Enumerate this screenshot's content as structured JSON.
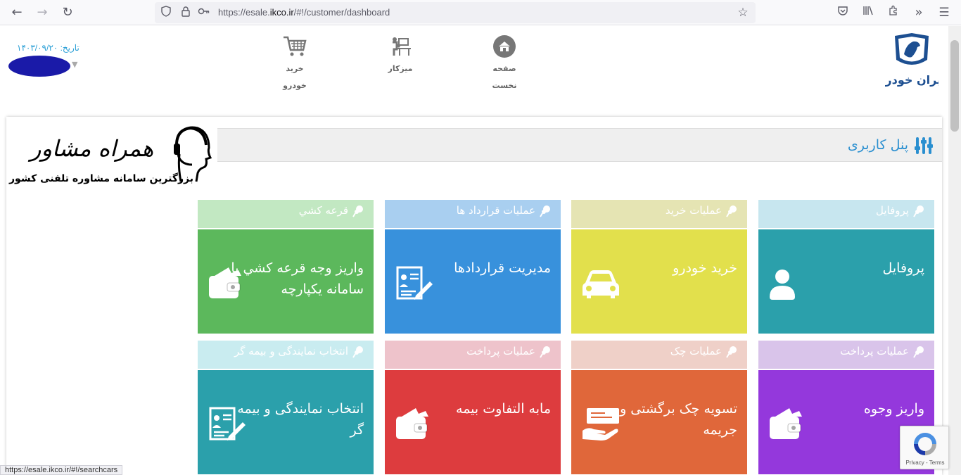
{
  "browser": {
    "url_prefix": "https://esale.",
    "url_domain": "ikco.ir",
    "url_rest": "/#!/customer/dashboard",
    "status_url": "https://esale.ikco.ir/#!/searchcars"
  },
  "header": {
    "nav": [
      {
        "label": "صفحه",
        "label2": "نخست",
        "icon": "home-icon"
      },
      {
        "label": "میزکار",
        "icon": "desk-icon"
      },
      {
        "label": "خرید خودرو",
        "icon": "cart-icon"
      }
    ],
    "date_label": "تاریخ: ۱۴۰۳/۰۹/۲۰",
    "logo_text": "ایران خودرو"
  },
  "panel": {
    "title": "پنل کاربری"
  },
  "ad": {
    "title": "همراه مشاور",
    "subtitle": "بزرگترین سامانه مشاوره تلفنی کشور"
  },
  "tiles": [
    {
      "caption": "پروفايل",
      "title": "پروفايل",
      "cap_color": "#c7e6ef",
      "body_color": "#2ba0ab",
      "icon": "user-icon"
    },
    {
      "caption": "عمليات خريد",
      "title": "خريد خودرو",
      "cap_color": "#e5e4b3",
      "body_color": "#e2e04c",
      "icon": "car-icon"
    },
    {
      "caption": "عمليات قرارداد ها",
      "title": "مديريت قراردادها",
      "cap_color": "#a9cff0",
      "body_color": "#3891dc",
      "icon": "contract-icon"
    },
    {
      "caption": "قرعه کشي",
      "title": "واريز وجه قرعه کشي يا سامانه يکپارچه",
      "cap_color": "#c2e8c2",
      "body_color": "#5cb85c",
      "icon": "wallet-icon"
    },
    {
      "caption": "عمليات پرداخت",
      "title": "واريز وجوه",
      "cap_color": "#d9c4ea",
      "body_color": "#9438dc",
      "icon": "wallet-icon"
    },
    {
      "caption": "عمليات چک",
      "title": "تسويه چک برگشتی و جريمه",
      "cap_color": "#efd0c8",
      "body_color": "#e0673a",
      "icon": "cheque-hand-icon"
    },
    {
      "caption": "عمليات پرداخت",
      "title": "مابه التفاوت بيمه",
      "cap_color": "#eec3cb",
      "body_color": "#dd3c3e",
      "icon": "wallet-icon"
    },
    {
      "caption": "انتخاب نمايندگی و بيمه گر",
      "title": "انتخاب نمايندگی و بيمه گر",
      "cap_color": "#c9ecf0",
      "body_color": "#2ba0ab",
      "icon": "contract-icon"
    }
  ],
  "recaptcha": {
    "links": "Privacy - Terms"
  }
}
